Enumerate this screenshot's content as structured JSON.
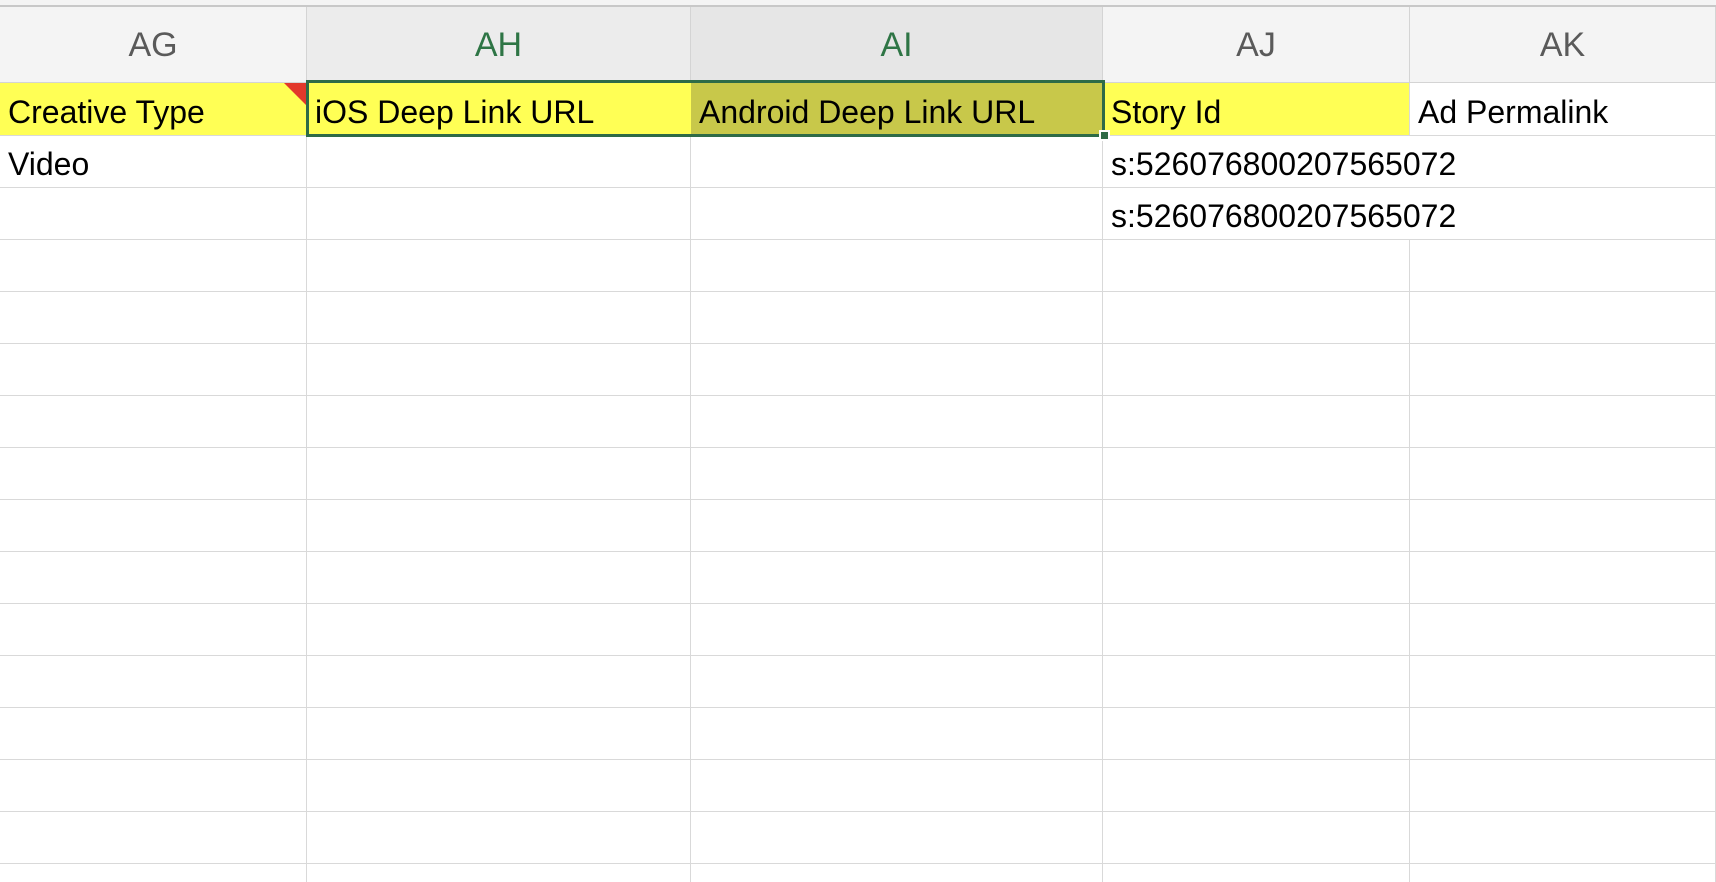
{
  "columns": [
    {
      "letter": "AG"
    },
    {
      "letter": "AH"
    },
    {
      "letter": "AI"
    },
    {
      "letter": "AJ"
    },
    {
      "letter": "AK"
    }
  ],
  "header_row": {
    "ag": "Creative Type",
    "ah": "iOS Deep Link URL",
    "ai": "Android Deep Link URL",
    "aj": "Story Id",
    "ak": "Ad Permalink"
  },
  "rows": [
    {
      "ag": "Video",
      "ah": "",
      "ai": "",
      "aj": "s:526076800207565072",
      "ak": ""
    },
    {
      "ag": "",
      "ah": "",
      "ai": "",
      "aj": "s:526076800207565072",
      "ak": ""
    }
  ],
  "colors": {
    "header_fill": "#ffff55",
    "selected_fill": "#c8c84a",
    "selection_border": "#2e6b47",
    "selected_header_text": "#2e7545",
    "comment_marker": "#e2382b"
  }
}
